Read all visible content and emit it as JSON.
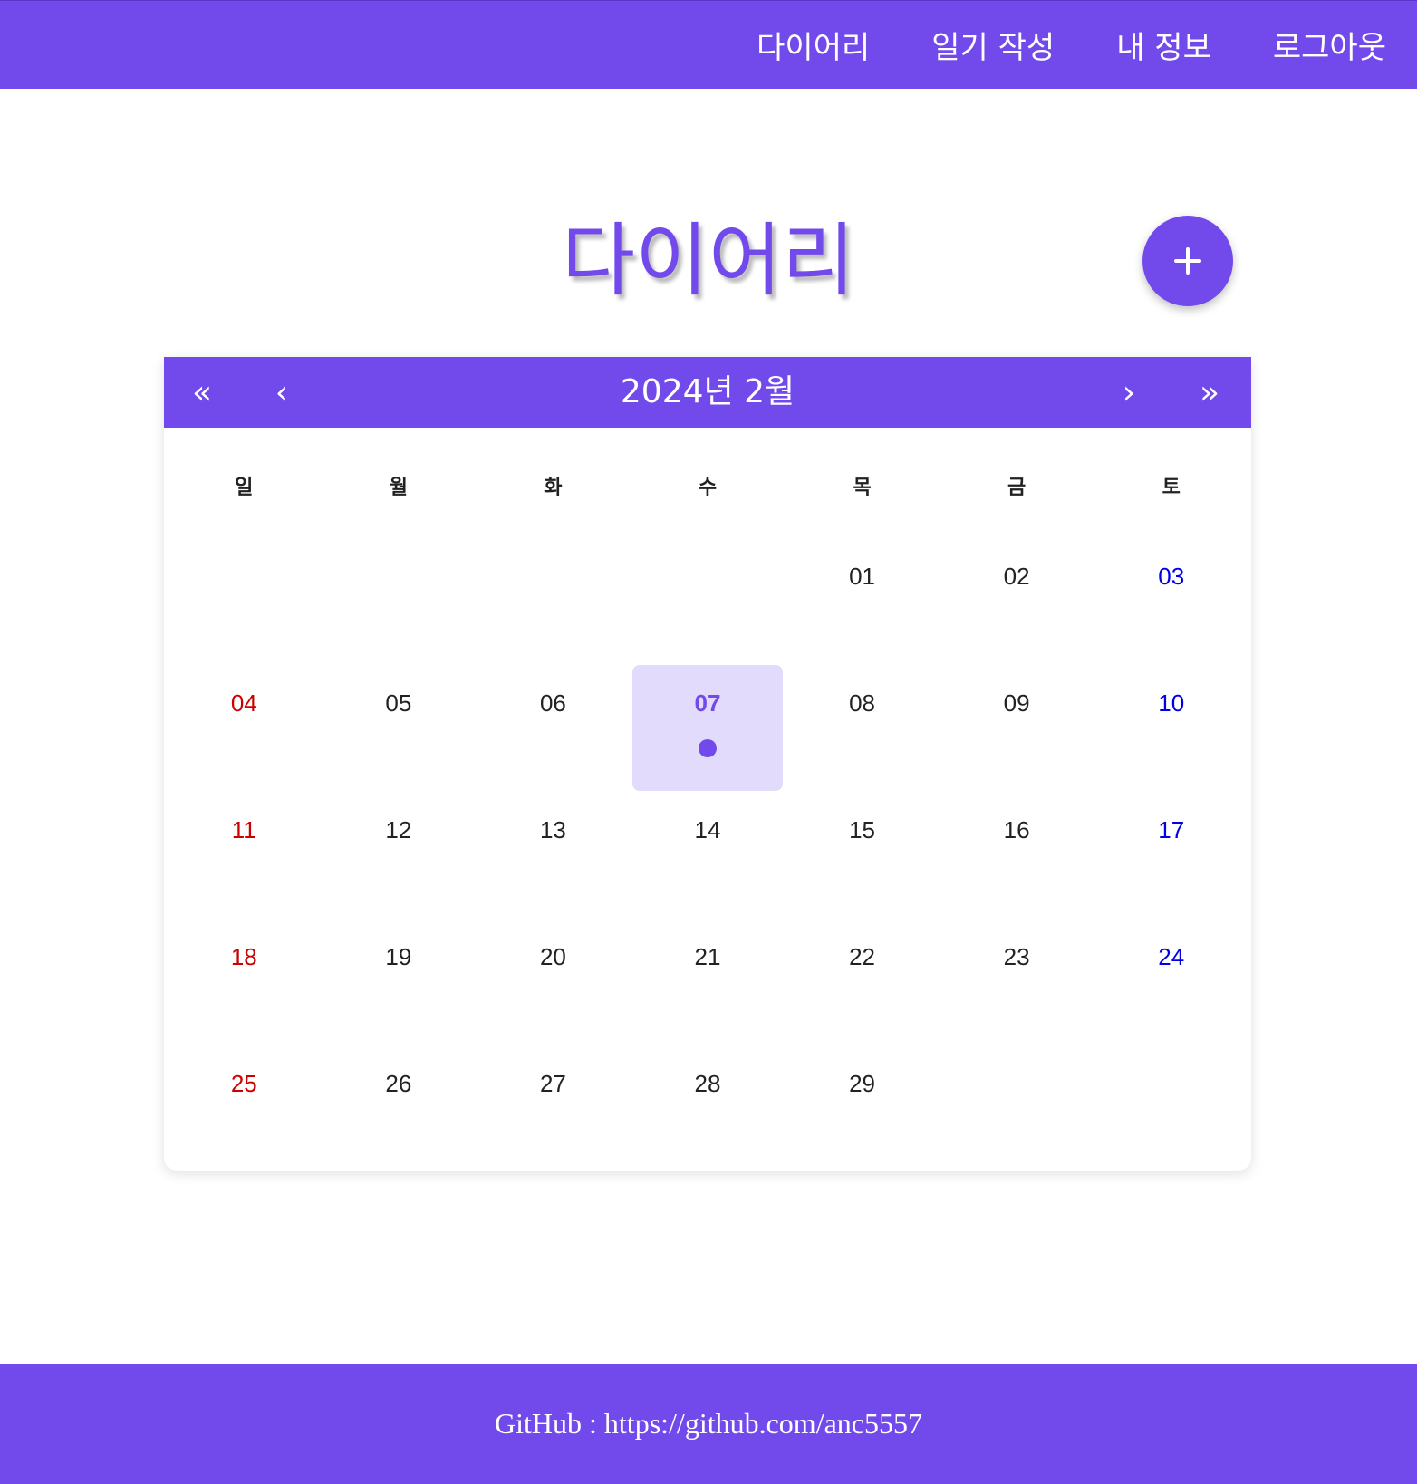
{
  "colors": {
    "brand": "#7249ea",
    "selected_bg": "#e2dbfb",
    "sunday": "#cc0000",
    "saturday": "#0000e6",
    "text": "#222222"
  },
  "nav": {
    "items": [
      {
        "label": "다이어리"
      },
      {
        "label": "일기 작성"
      },
      {
        "label": "내 정보"
      },
      {
        "label": "로그아웃"
      }
    ]
  },
  "page": {
    "title": "다이어리",
    "add_button_icon": "plus-icon"
  },
  "calendar": {
    "title": "2024년 2월",
    "nav": {
      "prev_year": "«",
      "prev_month": "‹",
      "next_month": "›",
      "next_year": "»"
    },
    "weekdays": [
      "일",
      "월",
      "화",
      "수",
      "목",
      "금",
      "토"
    ],
    "leading_blanks": 4,
    "days": [
      "01",
      "02",
      "03",
      "04",
      "05",
      "06",
      "07",
      "08",
      "09",
      "10",
      "11",
      "12",
      "13",
      "14",
      "15",
      "16",
      "17",
      "18",
      "19",
      "20",
      "21",
      "22",
      "23",
      "24",
      "25",
      "26",
      "27",
      "28",
      "29"
    ],
    "selected_day": "07",
    "days_with_entries": [
      "07"
    ]
  },
  "footer": {
    "text": "GitHub : https://github.com/anc5557"
  }
}
